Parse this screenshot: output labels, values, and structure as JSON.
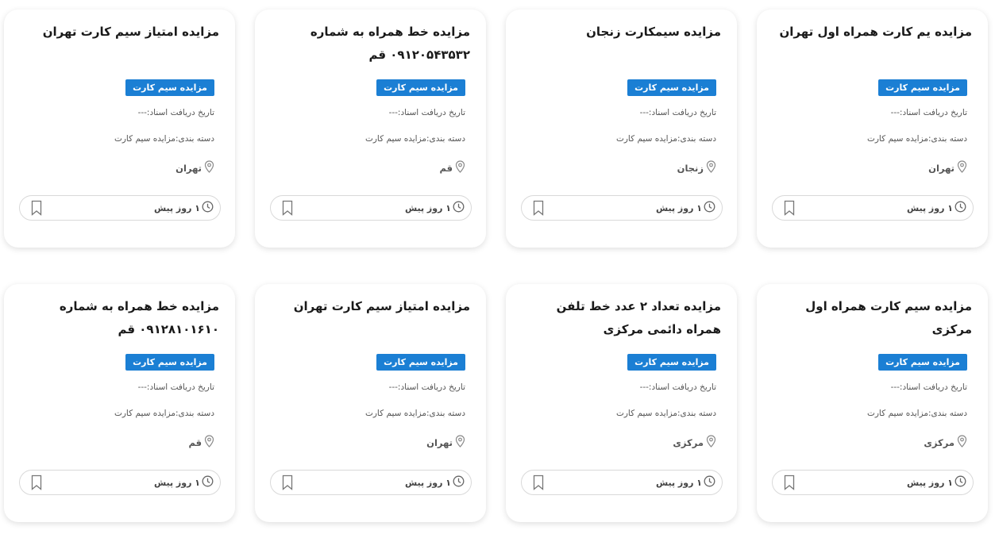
{
  "cards": [
    {
      "title": "مزایده یم کارت همراه اول تهران",
      "badge": "مزایده سیم کارت",
      "date": "تاریخ دریافت اسناد:---",
      "category": "دسته بندی:مزایده سیم کارت",
      "location": "تهران",
      "time": "۱ روز پیش"
    },
    {
      "title": "مزایده سیمکارت زنجان",
      "badge": "مزایده سیم کارت",
      "date": "تاریخ دریافت اسناد:---",
      "category": "دسته بندی:مزایده سیم کارت",
      "location": "زنجان",
      "time": "۱ روز پیش"
    },
    {
      "title": "مزایده خط همراه به شماره ۰۹۱۲۰۵۴۳۵۳۲ قم",
      "badge": "مزایده سیم کارت",
      "date": "تاریخ دریافت اسناد:---",
      "category": "دسته بندی:مزایده سیم کارت",
      "location": "قم",
      "time": "۱ روز پیش"
    },
    {
      "title": "مزایده امتیاز سیم کارت تهران",
      "badge": "مزایده سیم کارت",
      "date": "تاریخ دریافت اسناد:---",
      "category": "دسته بندی:مزایده سیم کارت",
      "location": "تهران",
      "time": "۱ روز پیش"
    },
    {
      "title": "مزایده سیم کارت همراه اول مرکزی",
      "badge": "مزایده سیم کارت",
      "date": "تاریخ دریافت اسناد:---",
      "category": "دسته بندی:مزایده سیم کارت",
      "location": "مرکزی",
      "time": "۱ روز پیش"
    },
    {
      "title": "مزایده تعداد ۲ عدد خط تلفن همراه دائمی مرکزی",
      "badge": "مزایده سیم کارت",
      "date": "تاریخ دریافت اسناد:---",
      "category": "دسته بندی:مزایده سیم کارت",
      "location": "مرکزی",
      "time": "۱ روز پیش"
    },
    {
      "title": "مزایده امتیاز سیم کارت تهران",
      "badge": "مزایده سیم کارت",
      "date": "تاریخ دریافت اسناد:---",
      "category": "دسته بندی:مزایده سیم کارت",
      "location": "تهران",
      "time": "۱ روز پیش"
    },
    {
      "title": "مزایده خط همراه به شماره ۰۹۱۲۸۱۰۱۶۱۰ قم",
      "badge": "مزایده سیم کارت",
      "date": "تاریخ دریافت اسناد:---",
      "category": "دسته بندی:مزایده سیم کارت",
      "location": "قم",
      "time": "۱ روز پیش"
    }
  ],
  "icons": {
    "location": "map-pin-icon",
    "time": "clock-icon",
    "bookmark": "bookmark-icon"
  },
  "colors": {
    "badge": "#1b7fd4",
    "icon": "#8a8a8a"
  }
}
